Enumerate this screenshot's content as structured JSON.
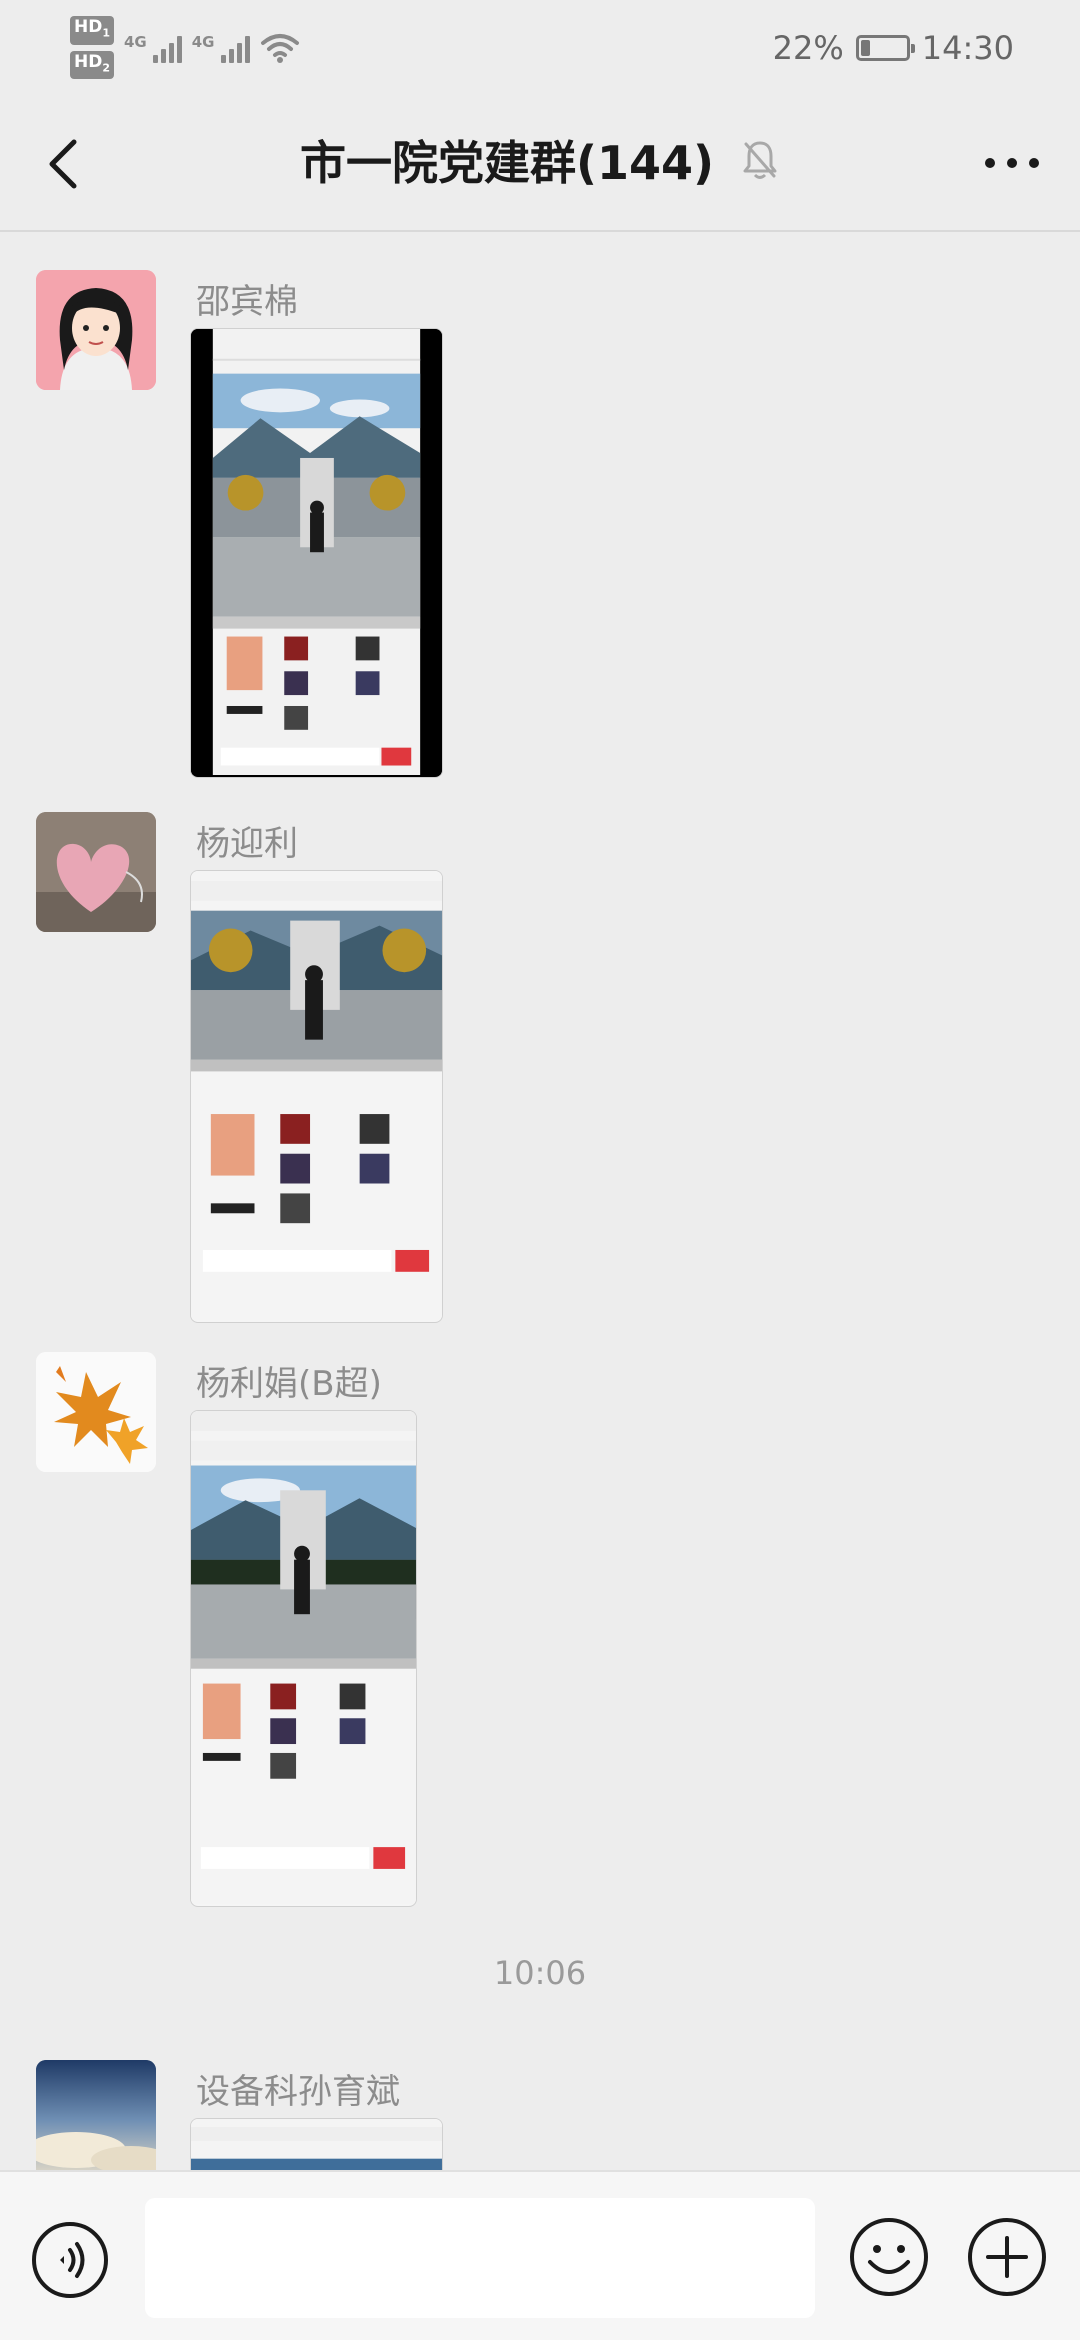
{
  "status_bar": {
    "hd1": "HD",
    "hd1_sub": "1",
    "hd2": "HD",
    "hd2_sub": "2",
    "net1": "4G",
    "net2": "4G",
    "battery_percent": "22%",
    "battery_level": 0.22,
    "time": "14:30"
  },
  "header": {
    "title": "市一院党建群(144)",
    "back_icon": "chevron-left-icon",
    "mute_icon": "bell-off-icon",
    "more_icon": "more-horizontal-icon"
  },
  "messages": [
    {
      "sender": "邵宾棉",
      "avatar": "cartoon-nurse-avatar",
      "content": "image"
    },
    {
      "sender": "杨迎利",
      "avatar": "knitted-heart-avatar",
      "content": "image"
    },
    {
      "sender": "杨利娟(B超)",
      "avatar": "autumn-leaves-avatar",
      "content": "image"
    },
    {
      "sender": "设备科孙育斌",
      "avatar": "sky-clouds-avatar",
      "content": "image"
    }
  ],
  "timestamp": "10:06",
  "input_bar": {
    "voice_icon": "voice-icon",
    "input_value": "",
    "emoji_icon": "smiley-icon",
    "plus_icon": "plus-circle-icon"
  },
  "colors": {
    "background": "#ededed",
    "accent_red": "#e0383e",
    "text_gray": "#8c8c8c"
  }
}
